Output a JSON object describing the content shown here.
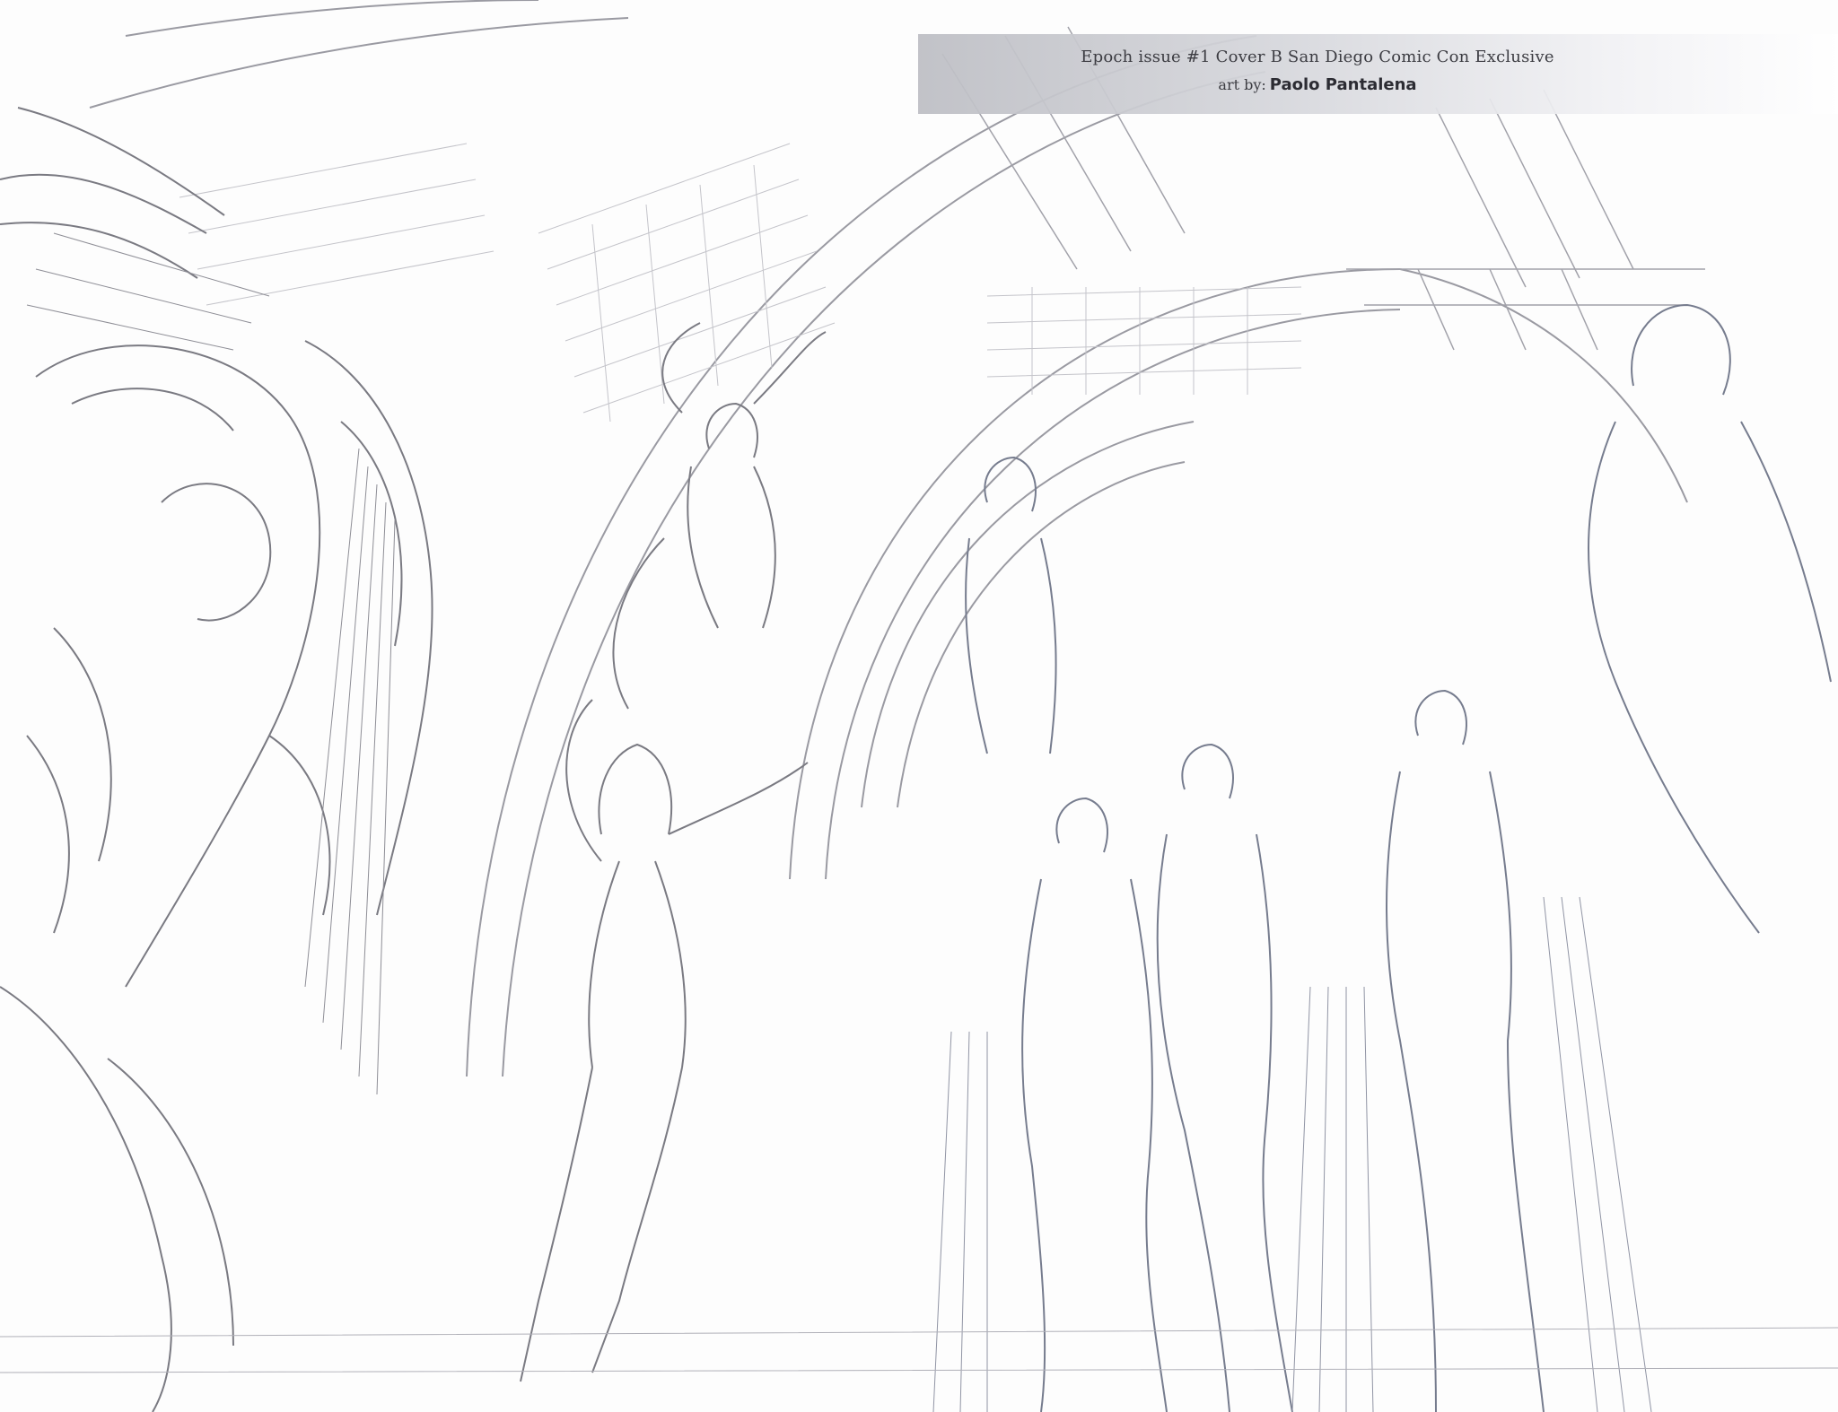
{
  "caption": {
    "title": "Epoch issue #1 Cover B San Diego Comic Con Exclusive",
    "credit_prefix": "art by:",
    "artist": "Paolo Pantalena"
  },
  "colors": {
    "paper": "#fdfdfd",
    "pencil": "#7a7a82",
    "banner": "#c9cacf"
  }
}
